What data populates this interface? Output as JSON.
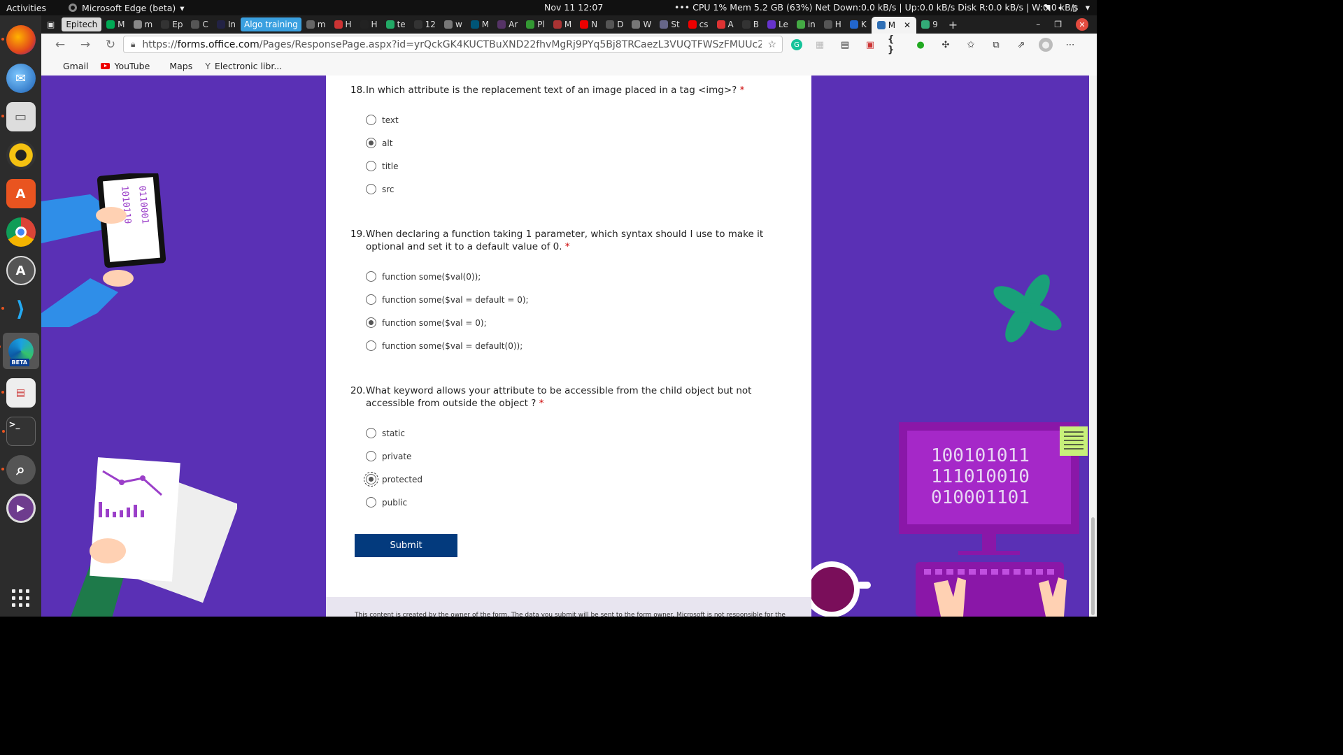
{
  "topbar": {
    "activities": "Activities",
    "app_name": "Microsoft Edge (beta)",
    "clock": "Nov 11  12:07",
    "stats": "••• CPU 1%   Mem 5.2 GB (63%)   Net Down:0.0 kB/s | Up:0.0 kB/s   Disk R:0.0 kB/s | W:0.0 kB/s"
  },
  "dock": {
    "apps": [
      "firefox-icon",
      "thunderbird-icon",
      "files-icon",
      "rhythmbox-icon",
      "software-center-icon",
      "chrome-icon",
      "ubuntu-updater-icon",
      "vscode-icon",
      "edge-beta-icon",
      "reader-icon",
      "terminal-icon",
      "search-icon",
      "media-player-icon"
    ],
    "edge_badge": "BETA"
  },
  "browser": {
    "tabs": [
      {
        "label": "Epitech",
        "kind": "epitech"
      },
      {
        "label": "M",
        "color": "#0a5"
      },
      {
        "label": "m",
        "color": "#888"
      },
      {
        "label": "Ep",
        "color": "#333"
      },
      {
        "label": "C",
        "color": "#555"
      },
      {
        "label": "In",
        "color": "#224"
      },
      {
        "label": "Algo training",
        "kind": "algo"
      },
      {
        "label": "m",
        "color": "#666"
      },
      {
        "label": "H",
        "color": "#c33"
      },
      {
        "label": "H",
        "color": "#222"
      },
      {
        "label": "te",
        "color": "#2a6"
      },
      {
        "label": "12",
        "color": "#333"
      },
      {
        "label": "w",
        "color": "#777"
      },
      {
        "label": "M",
        "color": "#057"
      },
      {
        "label": "Ar",
        "color": "#536"
      },
      {
        "label": "Pl",
        "color": "#393"
      },
      {
        "label": "M",
        "color": "#a33"
      },
      {
        "label": "N",
        "color": "#e00"
      },
      {
        "label": "D",
        "color": "#555"
      },
      {
        "label": "W",
        "color": "#777"
      },
      {
        "label": "St",
        "color": "#668"
      },
      {
        "label": "cs",
        "color": "#e00"
      },
      {
        "label": "A",
        "color": "#d33"
      },
      {
        "label": "B",
        "color": "#333"
      },
      {
        "label": "Le",
        "color": "#63c"
      },
      {
        "label": "in",
        "color": "#4a4"
      },
      {
        "label": "H",
        "color": "#555"
      },
      {
        "label": "K",
        "color": "#26c"
      },
      {
        "label": "M",
        "kind": "current"
      },
      {
        "label": "9",
        "color": "#3a7"
      }
    ],
    "url_prefix": "https://",
    "url_host": "forms.office.com",
    "url_rest": "/Pages/ResponsePage.aspx?id=yrQckGK4KUCTBuXND22fhvMgRj9PYq5Bj8TRCaezL3VUQTFWSzFMUUc2NVc2...",
    "bookmarks": [
      "Gmail",
      "YouTube",
      "Maps",
      "Electronic libr..."
    ]
  },
  "form": {
    "questions": [
      {
        "number": "18.",
        "text": "In which attribute is the replacement text of an image placed in a tag <img>?",
        "required": "*",
        "options": [
          "text",
          "alt",
          "title",
          "src"
        ],
        "selected": 1
      },
      {
        "number": "19.",
        "text": "When declaring a function taking 1 parameter, which syntax should I use to make it optional and set it to a default value of 0.",
        "required": "*",
        "options": [
          "function some($val(0));",
          "function some($val = default = 0);",
          "function some($val = 0);",
          "function some($val = default(0));"
        ],
        "selected": 2
      },
      {
        "number": "20.",
        "text": "What keyword allows your attribute to be accessible from the child object but not accessible from outside the object ?",
        "required": "*",
        "options": [
          "static",
          "private",
          "protected",
          "public"
        ],
        "selected": 2
      }
    ],
    "submit_label": "Submit",
    "footer": "This content is created by the owner of the form. The data you submit will be sent to the form owner. Microsoft is not responsible for the"
  },
  "decor": {
    "monitor_binary": [
      "100101011",
      "111010010",
      "010001101"
    ],
    "tablet_binary": [
      "1010110",
      "0110001"
    ]
  },
  "colors": {
    "page_bg": "#5a30b5",
    "submit_bg": "#033a7d",
    "required": "#c00000"
  }
}
